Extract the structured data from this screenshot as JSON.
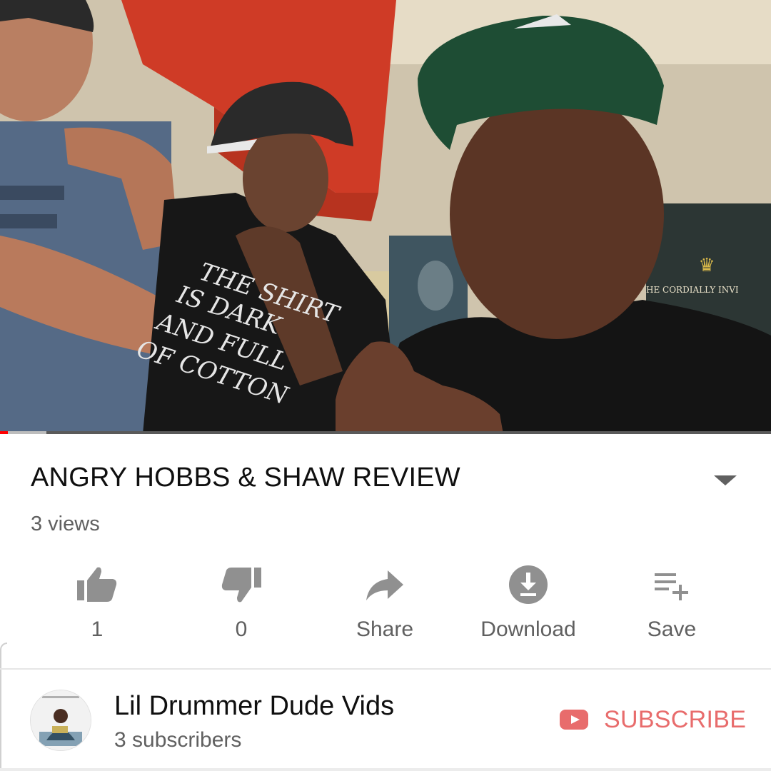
{
  "video": {
    "title": "ANGRY HOBBS & SHAW REVIEW",
    "views": "3 views",
    "progress_fraction": 0.01,
    "buffer_fraction": 0.06,
    "scene_text": {
      "shirt": [
        "THE SHIRT",
        "IS DARK",
        "AND FULL",
        "OF COTTON"
      ],
      "poster": "HE CORDIALLY INVI"
    }
  },
  "actions": {
    "like": {
      "label": "1",
      "icon": "thumbs-up-icon"
    },
    "dislike": {
      "label": "0",
      "icon": "thumbs-down-icon"
    },
    "share": {
      "label": "Share",
      "icon": "share-arrow-icon"
    },
    "download": {
      "label": "Download",
      "icon": "download-circle-icon"
    },
    "save": {
      "label": "Save",
      "icon": "playlist-add-icon"
    }
  },
  "channel": {
    "name": "Lil Drummer Dude Vids",
    "subscribers": "3 subscribers",
    "subscribe_label": "SUBSCRIBE"
  },
  "colors": {
    "accent_red": "#ff0000",
    "subscribe_text": "#e86c6c",
    "icon_gray": "#909090",
    "secondary_text": "#606060"
  }
}
